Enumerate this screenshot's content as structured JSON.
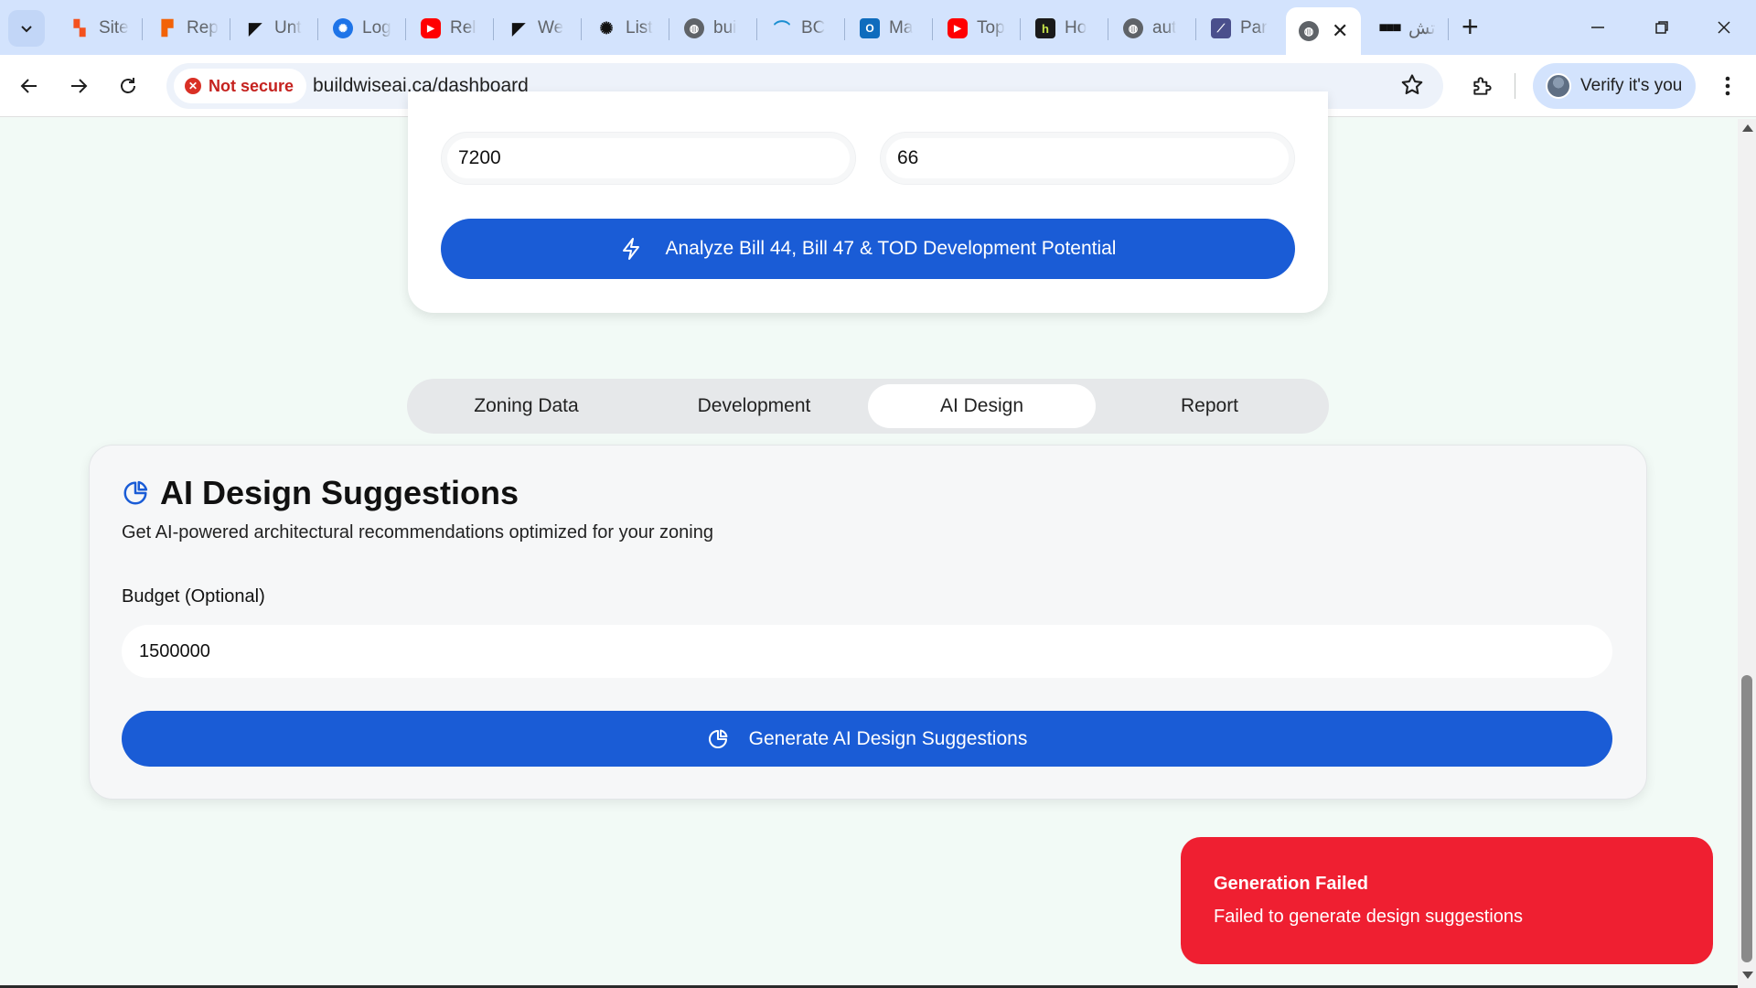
{
  "browser": {
    "tabs": [
      {
        "label": "Site",
        "icon": "site-favicon"
      },
      {
        "label": "Rep",
        "icon": "replit-favicon"
      },
      {
        "label": "Unt",
        "icon": "framer-favicon"
      },
      {
        "label": "Log",
        "icon": "openai-blue-favicon"
      },
      {
        "label": "Rel",
        "icon": "youtube-favicon"
      },
      {
        "label": "We",
        "icon": "framer-favicon"
      },
      {
        "label": "List",
        "icon": "openai-favicon"
      },
      {
        "label": "bui",
        "icon": "globe-favicon"
      },
      {
        "label": "BC",
        "icon": "bc-favicon"
      },
      {
        "label": "Ma",
        "icon": "outlook-favicon"
      },
      {
        "label": "Top",
        "icon": "youtube-favicon"
      },
      {
        "label": "Ho",
        "icon": "houzz-favicon"
      },
      {
        "label": "aut",
        "icon": "globe-favicon"
      },
      {
        "label": "Par",
        "icon": "chart-favicon"
      }
    ],
    "active_tab": {
      "icon": "globe-favicon",
      "close": "✕"
    },
    "last_tab": {
      "label": "تش",
      "icon": "dots-favicon"
    },
    "security_label": "Not secure",
    "url": "buildwiseai.ca/dashboard",
    "profile_label": "Verify it's you"
  },
  "form": {
    "field_left_value": "7200",
    "field_right_value": "66",
    "analyze_label": "Analyze Bill 44, Bill 47 & TOD Development Potential"
  },
  "tabs": {
    "items": [
      {
        "label": "Zoning Data"
      },
      {
        "label": "Development"
      },
      {
        "label": "AI Design"
      },
      {
        "label": "Report"
      }
    ],
    "selected": "AI Design"
  },
  "ai_design": {
    "title": "AI Design Suggestions",
    "subtitle": "Get AI-powered architectural recommendations optimized for your zoning",
    "budget_label": "Budget (Optional)",
    "budget_value": "1500000",
    "generate_label": "Generate AI Design Suggestions"
  },
  "toast": {
    "title": "Generation Failed",
    "message": "Failed to generate design suggestions"
  },
  "colors": {
    "primary": "#1a5cd6",
    "toast": "#ef1f31",
    "page_bg": "#f2faf6",
    "tabstrip": "#d3e3fd"
  }
}
